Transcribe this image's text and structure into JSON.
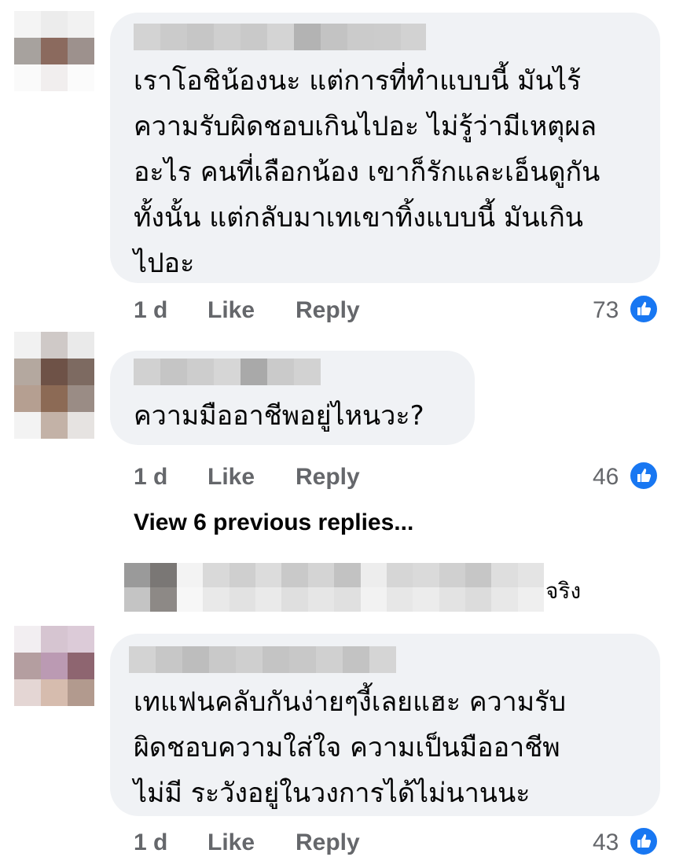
{
  "comments": [
    {
      "text": "เราโอชิน้องนะ แต่การที่ทำแบบนี้ มันไร้\nความรับผิดชอบเกินไปอะ ไม่รู้ว่ามีเหตุผล\nอะไร คนที่เลือกน้อง เขาก็รักและเอ็นดูกัน\nทั้งนั้น แต่กลับมาเทเขาทิ้งแบบนี้ มันเกิน\nไปอะ",
      "time": "1 d",
      "like_label": "Like",
      "reply_label": "Reply",
      "reaction_count": "73"
    },
    {
      "text": "ความมืออาชีพอยู่ไหนวะ?",
      "time": "1 d",
      "like_label": "Like",
      "reply_label": "Reply",
      "reaction_count": "46"
    },
    {
      "text": "เทแฟนคลับกันง่ายๆงี้เลยแฮะ ความรับ\nผิดชอบความใส่ใจ ความเป็นมืออาชีพ\nไม่มี ระวังอยู่ในวงการได้ไม่นานนะ",
      "time": "1 d",
      "like_label": "Like",
      "reply_label": "Reply",
      "reaction_count": "43"
    }
  ],
  "view_previous_label": "View 6 previous replies...",
  "reply_preview_text": "จริง",
  "colors": {
    "bubble_bg": "#f0f2f5",
    "meta_text": "#65676b",
    "like_blue": "#1877f2"
  },
  "icons": [
    "like-reaction-icon"
  ]
}
